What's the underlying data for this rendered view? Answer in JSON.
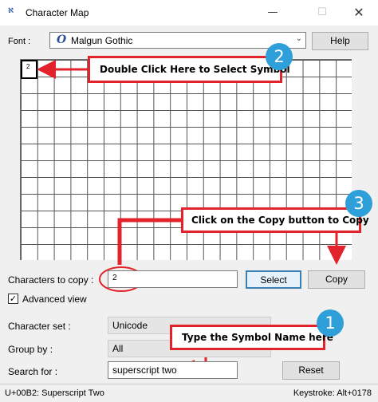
{
  "window": {
    "title": "Character Map",
    "app_icon": "character-map-icon",
    "controls": {
      "minimize": "—",
      "maximize": "☐",
      "close": "✕"
    }
  },
  "font_row": {
    "label": "Font :",
    "value": "Malgun Gothic",
    "glyph": "O",
    "help_label": "Help"
  },
  "grid": {
    "selected_char": "2"
  },
  "callouts": [
    {
      "text": "Double Click Here to Select Symbol",
      "badge": "2"
    },
    {
      "text": "Click on the Copy button to Copy",
      "badge": "3"
    },
    {
      "text": "Type the Symbol Name here",
      "badge": "1"
    }
  ],
  "copy_row": {
    "label": "Characters to copy :",
    "value": "2",
    "select_label": "Select",
    "copy_label": "Copy"
  },
  "advanced_view": {
    "label": "Advanced view",
    "checked": true,
    "mark": "✓"
  },
  "character_set": {
    "label": "Character set :",
    "value": "Unicode"
  },
  "group_by": {
    "label": "Group by :",
    "value": "All"
  },
  "search": {
    "label": "Search for :",
    "value": "superscript two",
    "reset_label": "Reset"
  },
  "status": {
    "left": "U+00B2: Superscript Two",
    "right": "Keystroke: Alt+0178"
  },
  "colors": {
    "callout_border": "#e2232b",
    "badge": "#2e9fd8",
    "arrow": "#e2232b"
  }
}
